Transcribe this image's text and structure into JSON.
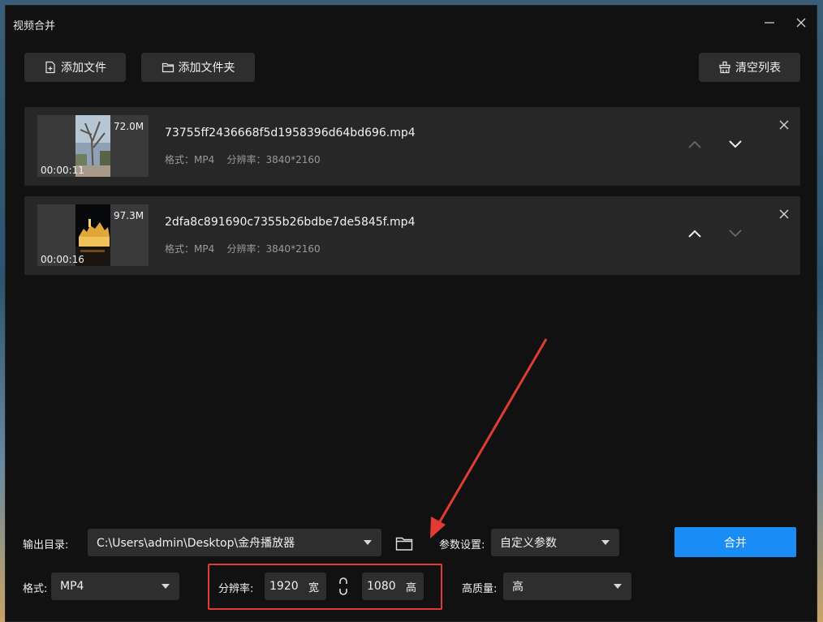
{
  "window": {
    "title": "视频合并"
  },
  "toolbar": {
    "add_file": "添加文件",
    "add_folder": "添加文件夹",
    "clear_list": "清空列表"
  },
  "files": [
    {
      "name": "73755ff2436668f5d1958396d64bd696.mp4",
      "size": "72.0M",
      "duration": "00:00:11",
      "format_label": "格式：",
      "format": "MP4",
      "resolution_label": "分辨率：",
      "resolution": "3840*2160"
    },
    {
      "name": "2dfa8c891690c7355b26bdbe7de5845f.mp4",
      "size": "97.3M",
      "duration": "00:00:16",
      "format_label": "格式：",
      "format": "MP4",
      "resolution_label": "分辨率：",
      "resolution": "3840*2160"
    }
  ],
  "output": {
    "label": "输出目录:",
    "path": "C:\\Users\\admin\\Desktop\\金舟播放器"
  },
  "params": {
    "label": "参数设置:",
    "value": "自定义参数"
  },
  "format": {
    "label": "格式:",
    "value": "MP4"
  },
  "resolution": {
    "label": "分辨率:",
    "width": "1920",
    "width_unit": "宽",
    "height": "1080",
    "height_unit": "高"
  },
  "quality": {
    "label": "高质量:",
    "value": "高"
  },
  "merge_button": "合并",
  "colors": {
    "accent": "#1a8cf5",
    "highlight": "#e23b34"
  }
}
